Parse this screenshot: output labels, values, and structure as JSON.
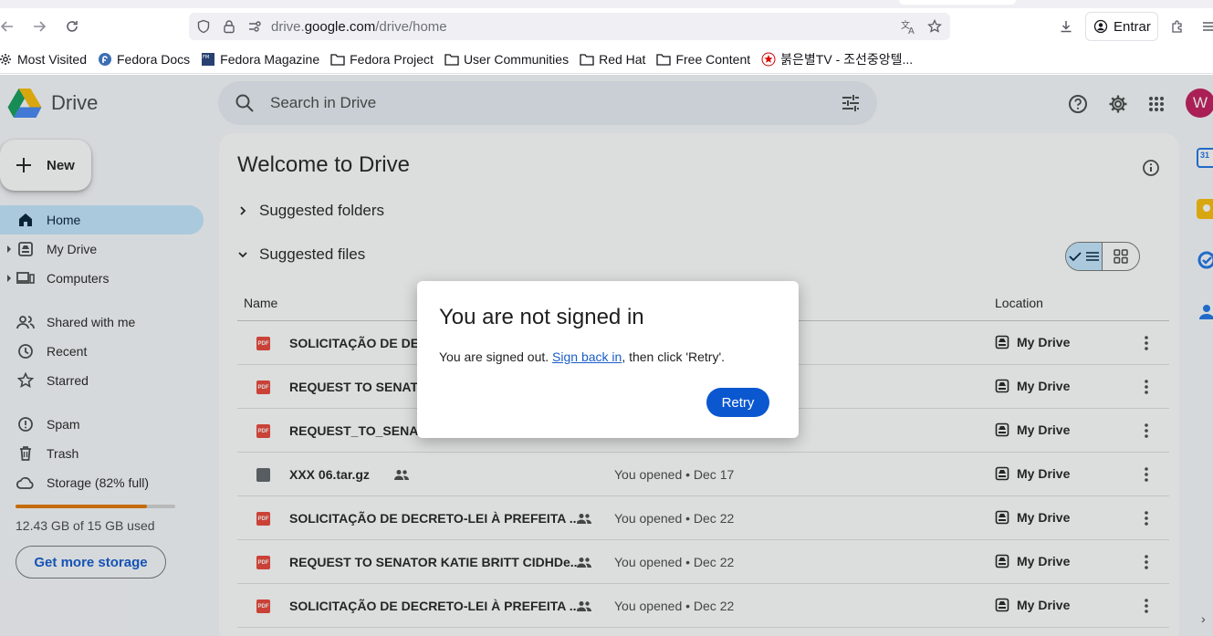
{
  "browser": {
    "url_prefix": "drive.",
    "url_host": "google.com",
    "url_path": "/drive/home",
    "signin_label": "Entrar",
    "bookmarks": [
      {
        "label": "Most Visited",
        "icon": "gear-icon"
      },
      {
        "label": "Fedora Docs",
        "icon": "fedora-icon"
      },
      {
        "label": "Fedora Magazine",
        "icon": "fedora-magazine-icon"
      },
      {
        "label": "Fedora Project",
        "icon": "folder-icon"
      },
      {
        "label": "User Communities",
        "icon": "folder-icon"
      },
      {
        "label": "Red Hat",
        "icon": "folder-icon"
      },
      {
        "label": "Free Content",
        "icon": "folder-icon"
      },
      {
        "label": "붉은별TV - 조선중앙텔...",
        "icon": "star-icon"
      }
    ]
  },
  "drive": {
    "app_name": "Drive",
    "search_placeholder": "Search in Drive",
    "avatar_letter": "W",
    "new_label": "New",
    "nav": [
      {
        "label": "Home",
        "icon": "home-icon",
        "active": true
      },
      {
        "label": "My Drive",
        "icon": "my-drive-icon"
      },
      {
        "label": "Computers",
        "icon": "computers-icon"
      },
      {
        "label": "Shared with me",
        "icon": "shared-icon"
      },
      {
        "label": "Recent",
        "icon": "clock-icon"
      },
      {
        "label": "Starred",
        "icon": "star-icon"
      },
      {
        "label": "Spam",
        "icon": "spam-icon"
      },
      {
        "label": "Trash",
        "icon": "trash-icon"
      },
      {
        "label": "Storage (82% full)",
        "icon": "cloud-icon"
      }
    ],
    "storage_fraction": 0.82,
    "storage_text": "12.43 GB of 15 GB used",
    "get_more_storage": "Get more storage",
    "welcome": "Welcome to Drive",
    "suggested_folders": "Suggested folders",
    "suggested_files": "Suggested files",
    "columns": {
      "name": "Name",
      "location": "Location"
    },
    "files": [
      {
        "name": "SOLICITAÇÃO DE DEC",
        "type": "pdf",
        "opened": "",
        "location": "My Drive",
        "shared": false
      },
      {
        "name": "REQUEST TO SENATO",
        "type": "pdf",
        "opened": "",
        "location": "My Drive",
        "shared": false
      },
      {
        "name": "REQUEST_TO_SENATO",
        "type": "pdf",
        "opened": "",
        "location": "My Drive",
        "shared": false
      },
      {
        "name": "XXX 06.tar.gz",
        "type": "archive",
        "opened": "You opened • Dec 17",
        "location": "My Drive",
        "shared": true
      },
      {
        "name": "SOLICITAÇÃO DE DECRETO-LEI À PREFEITA ...",
        "type": "pdf",
        "opened": "You opened • Dec 22",
        "location": "My Drive",
        "shared": true
      },
      {
        "name": "REQUEST TO SENATOR KATIE BRITT CIDHDe...",
        "type": "pdf",
        "opened": "You opened • Dec 22",
        "location": "My Drive",
        "shared": true
      },
      {
        "name": "SOLICITAÇÃO DE DECRETO-LEI À PREFEITA ...",
        "type": "pdf",
        "opened": "You opened • Dec 22",
        "location": "My Drive",
        "shared": true
      }
    ]
  },
  "dialog": {
    "title": "You are not signed in",
    "message_before": "You are signed out. ",
    "link": "Sign back in",
    "message_after": ", then click 'Retry'.",
    "button": "Retry"
  }
}
